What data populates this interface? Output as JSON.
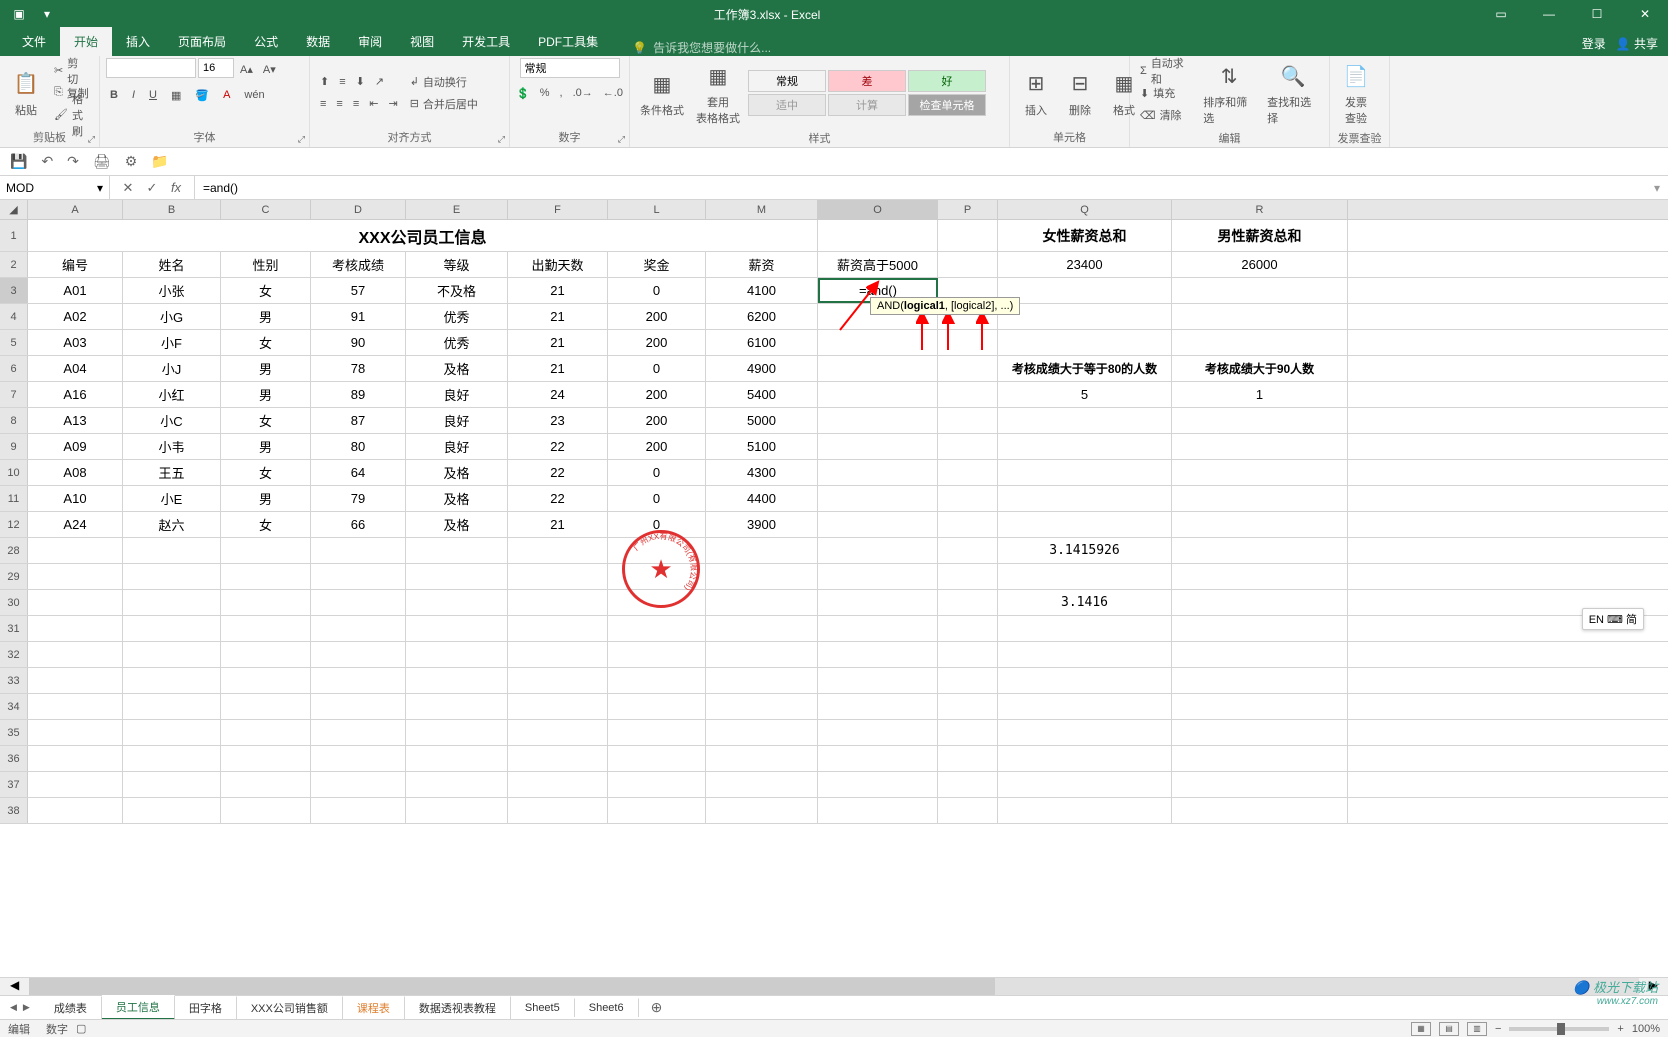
{
  "window": {
    "title": "工作簿3.xlsx - Excel",
    "login": "登录",
    "share": "共享"
  },
  "menus": [
    "文件",
    "开始",
    "插入",
    "页面布局",
    "公式",
    "数据",
    "审阅",
    "视图",
    "开发工具",
    "PDF工具集"
  ],
  "tellme": "告诉我您想要做什么...",
  "ribbon": {
    "clipboard": {
      "label": "剪贴板",
      "paste": "粘贴",
      "cut": "剪切",
      "copy": "复制",
      "format_painter": "格式刷"
    },
    "font": {
      "label": "字体",
      "size": "16"
    },
    "alignment": {
      "label": "对齐方式",
      "wrap": "自动换行",
      "merge": "合并后居中"
    },
    "number": {
      "label": "数字",
      "format": "常规"
    },
    "styles": {
      "label": "样式",
      "conditional": "条件格式",
      "table": "套用\n表格格式",
      "normal": "常规",
      "bad": "差",
      "good": "好",
      "neutral": "适中",
      "calc": "计算",
      "check": "检查单元格"
    },
    "cells": {
      "label": "单元格",
      "insert": "插入",
      "delete": "删除",
      "format": "格式"
    },
    "editing": {
      "label": "编辑",
      "sum": "自动求和",
      "fill": "填充",
      "clear": "清除",
      "sort": "排序和筛选",
      "find": "查找和选择"
    },
    "invoice": {
      "label": "发票查验",
      "check": "发票\n查验"
    }
  },
  "formulabar": {
    "namebox": "MOD",
    "formula": "=and()"
  },
  "columns": [
    "A",
    "B",
    "C",
    "D",
    "E",
    "F",
    "L",
    "M",
    "O",
    "P",
    "Q",
    "R"
  ],
  "table": {
    "title": "XXX公司员工信息",
    "headers": [
      "编号",
      "姓名",
      "性别",
      "考核成绩",
      "等级",
      "出勤天数",
      "奖金",
      "薪资",
      "薪资高于5000"
    ],
    "q_header": "女性薪资总和",
    "r_header": "男性薪资总和",
    "q_val": "23400",
    "r_val": "26000",
    "rows": [
      [
        "A01",
        "小张",
        "女",
        "57",
        "不及格",
        "21",
        "0",
        "4100",
        ""
      ],
      [
        "A02",
        "小G",
        "男",
        "91",
        "优秀",
        "21",
        "200",
        "6200",
        ""
      ],
      [
        "A03",
        "小F",
        "女",
        "90",
        "优秀",
        "21",
        "200",
        "6100",
        ""
      ],
      [
        "A04",
        "小J",
        "男",
        "78",
        "及格",
        "21",
        "0",
        "4900",
        ""
      ],
      [
        "A16",
        "小红",
        "男",
        "89",
        "良好",
        "24",
        "200",
        "5400",
        ""
      ],
      [
        "A13",
        "小C",
        "女",
        "87",
        "良好",
        "23",
        "200",
        "5000",
        ""
      ],
      [
        "A09",
        "小韦",
        "男",
        "80",
        "良好",
        "22",
        "200",
        "5100",
        ""
      ],
      [
        "A08",
        "王五",
        "女",
        "64",
        "及格",
        "22",
        "0",
        "4300",
        ""
      ],
      [
        "A10",
        "小E",
        "男",
        "79",
        "及格",
        "22",
        "0",
        "4400",
        ""
      ],
      [
        "A24",
        "赵六",
        "女",
        "66",
        "及格",
        "21",
        "0",
        "3900",
        ""
      ]
    ],
    "editing_cell": "=and()",
    "q_label2": "考核成绩大于等于80的人数",
    "r_label2": "考核成绩大于90人数",
    "q_val2": "5",
    "r_val2": "1",
    "pi1": "3.1415926",
    "pi2": "3.1416"
  },
  "tooltip": {
    "fn": "AND",
    "arg1": "logical1",
    "args": ", [logical2], ...)"
  },
  "row_nums_top": [
    "1",
    "2",
    "3",
    "4",
    "5",
    "6",
    "7",
    "8",
    "9",
    "10",
    "11",
    "12"
  ],
  "row_nums_bottom": [
    "28",
    "29",
    "30",
    "31",
    "32",
    "33",
    "34",
    "35",
    "36",
    "37",
    "38"
  ],
  "ime": "EN ⌨ 简",
  "sheets": [
    "成绩表",
    "员工信息",
    "田字格",
    "XXX公司销售额",
    "课程表",
    "数据透视表教程",
    "Sheet5",
    "Sheet6"
  ],
  "statusbar": {
    "mode": "编辑",
    "count_label": "数字",
    "zoom": "100%"
  },
  "watermark": {
    "name": "极光下载站",
    "site": "www.xz7.com"
  }
}
